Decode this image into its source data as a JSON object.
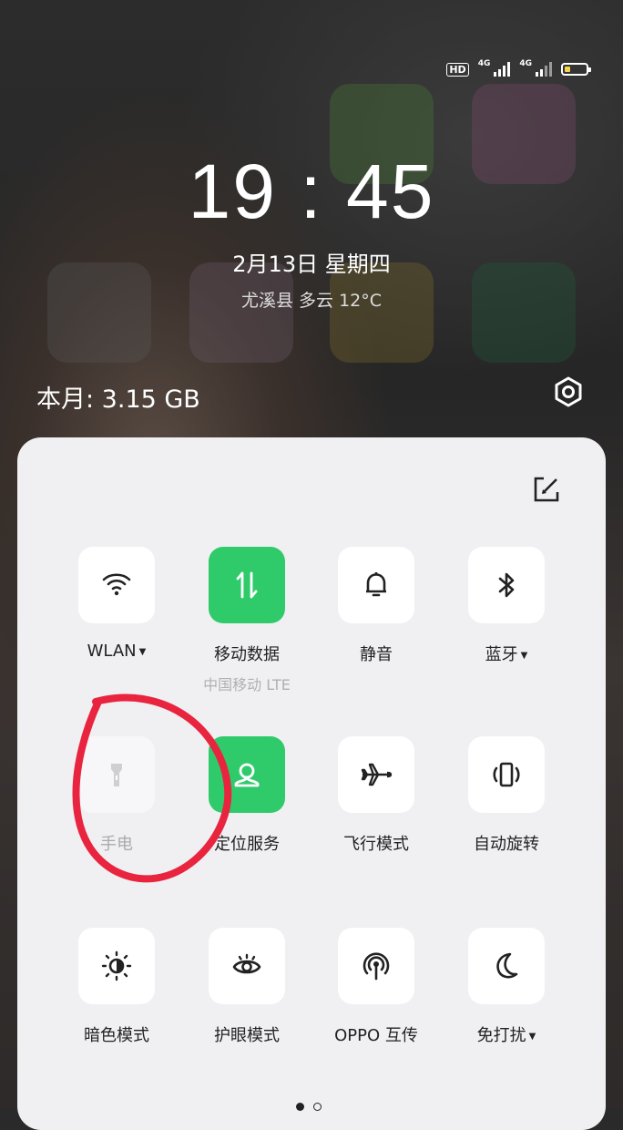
{
  "status_bar": {
    "hd_label": "HD",
    "net1": "4G",
    "net2": "4G",
    "battery_level": 0.25,
    "battery_color": "#f5d646"
  },
  "lock": {
    "time": "19 : 45",
    "date": "2月13日  星期四",
    "weather": "尤溪县 多云 12°C"
  },
  "data_usage": {
    "label": "本月: 3.15 GB"
  },
  "panel": {
    "tiles": [
      {
        "label": "WLAN",
        "has_caret": true,
        "icon": "wifi-icon",
        "state": "off"
      },
      {
        "label": "移动数据",
        "sub": "中国移动 LTE",
        "icon": "mobile-data-icon",
        "state": "on"
      },
      {
        "label": "静音",
        "icon": "bell-icon",
        "state": "off"
      },
      {
        "label": "蓝牙",
        "has_caret": true,
        "icon": "bluetooth-icon",
        "state": "off"
      },
      {
        "label": "手电",
        "icon": "flashlight-icon",
        "state": "disabled"
      },
      {
        "label": "定位服务",
        "icon": "location-icon",
        "state": "on"
      },
      {
        "label": "飞行模式",
        "icon": "airplane-icon",
        "state": "off"
      },
      {
        "label": "自动旋转",
        "icon": "rotate-icon",
        "state": "off"
      },
      {
        "label": "暗色模式",
        "icon": "dark-mode-icon",
        "state": "off"
      },
      {
        "label": "护眼模式",
        "icon": "eye-icon",
        "state": "off"
      },
      {
        "label": "OPPO 互传",
        "icon": "oppo-share-icon",
        "state": "off"
      },
      {
        "label": "免打扰",
        "has_caret": true,
        "icon": "moon-icon",
        "state": "off"
      }
    ],
    "page_count": 2,
    "active_page": 1
  },
  "colors": {
    "accent_on": "#2fcb6b",
    "annotation": "#e8243f"
  }
}
